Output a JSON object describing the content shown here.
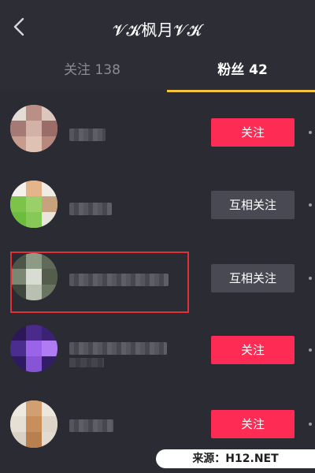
{
  "header": {
    "title": "𝓥𝓚枫月𝓥𝓚",
    "back_icon": "chevron-left-icon"
  },
  "tabs": [
    {
      "label": "关注 138",
      "active": false
    },
    {
      "label": "粉丝 42",
      "active": true
    }
  ],
  "colors": {
    "background": "#2b2b33",
    "follow_button": "#fe2c55",
    "mutual_button": "#494953",
    "tab_indicator": "#f5c43c",
    "highlight_border": "#e0303a"
  },
  "fans": [
    {
      "nickname": "",
      "action": "关注",
      "action_type": "follow"
    },
    {
      "nickname": "",
      "action": "互相关注",
      "action_type": "mutual"
    },
    {
      "nickname": "",
      "action": "互相关注",
      "action_type": "mutual"
    },
    {
      "nickname": "",
      "action": "关注",
      "action_type": "follow"
    },
    {
      "nickname": "",
      "action": "关注",
      "action_type": "follow"
    }
  ],
  "watermark": "来源：H12.NET"
}
